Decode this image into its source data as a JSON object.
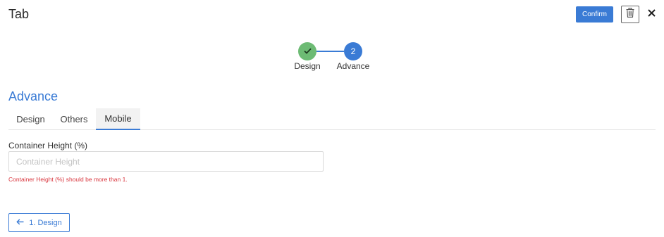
{
  "header": {
    "title": "Tab",
    "confirm_label": "Confirm"
  },
  "stepper": {
    "steps": [
      {
        "label": "Design",
        "number": "1",
        "status": "completed",
        "icon": "check-icon"
      },
      {
        "label": "Advance",
        "number": "2",
        "status": "active"
      }
    ]
  },
  "section": {
    "title": "Advance",
    "tabs": [
      {
        "label": "Design",
        "active": false
      },
      {
        "label": "Others",
        "active": false
      },
      {
        "label": "Mobile",
        "active": true
      }
    ]
  },
  "form": {
    "container_height": {
      "label": "Container Height (%)",
      "placeholder": "Container Height",
      "value": "",
      "error": "Container Height (%) should be more than 1."
    }
  },
  "footer": {
    "back_label": "1. Design"
  },
  "colors": {
    "accent": "#3a7bd5",
    "success": "#6dbb74",
    "error": "#d9363e"
  }
}
